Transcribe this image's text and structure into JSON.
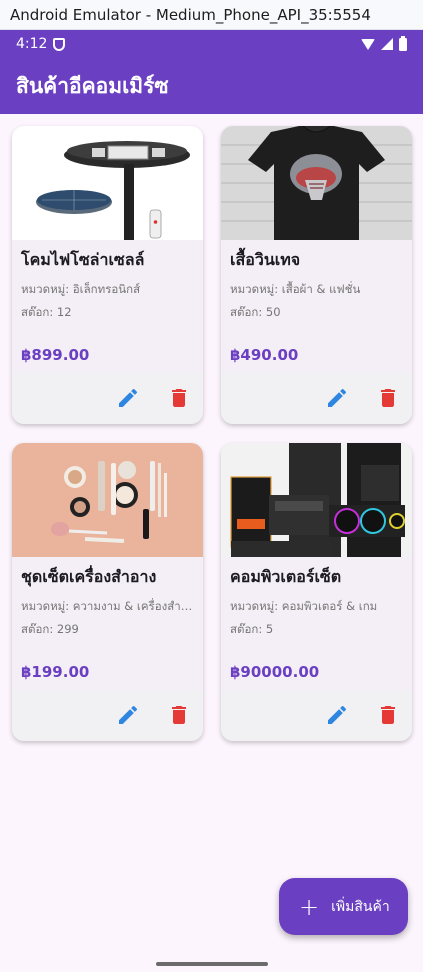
{
  "window": {
    "title": "Android Emulator - Medium_Phone_API_35:5554"
  },
  "status_bar": {
    "time": "4:12"
  },
  "app_bar": {
    "title": "สินค้าอีคอมเมิร์ซ"
  },
  "products": [
    {
      "name": "โคมไฟโซล่าเซลล์",
      "category": "หมวดหมู่: อิเล็กทรอนิกส์",
      "stock": "สต๊อก: 12",
      "price": "฿899.00",
      "image": "solar-lamp"
    },
    {
      "name": "เสื้อวินเทจ",
      "category": "หมวดหมู่: เสื้อผ้า & แฟชั่น",
      "stock": "สต๊อก: 50",
      "price": "฿490.00",
      "image": "vintage-tshirt"
    },
    {
      "name": "ชุดเซ็ตเครื่องสำอาง",
      "category": "หมวดหมู่: ความงาม & เครื่องสำอาง",
      "stock": "สต๊อก: 299",
      "price": "฿199.00",
      "image": "cosmetics-set"
    },
    {
      "name": "คอมพิวเตอร์เซ็ต",
      "category": "หมวดหมู่: คอมพิวเตอร์ & เกม",
      "stock": "สต๊อก: 5",
      "price": "฿90000.00",
      "image": "computer-parts"
    }
  ],
  "fab": {
    "label": "เพิ่มสินค้า"
  },
  "colors": {
    "primary": "#6a3fc1",
    "edit_icon": "#2f86e0",
    "delete_icon": "#e53935",
    "background": "#fdf5fd"
  }
}
